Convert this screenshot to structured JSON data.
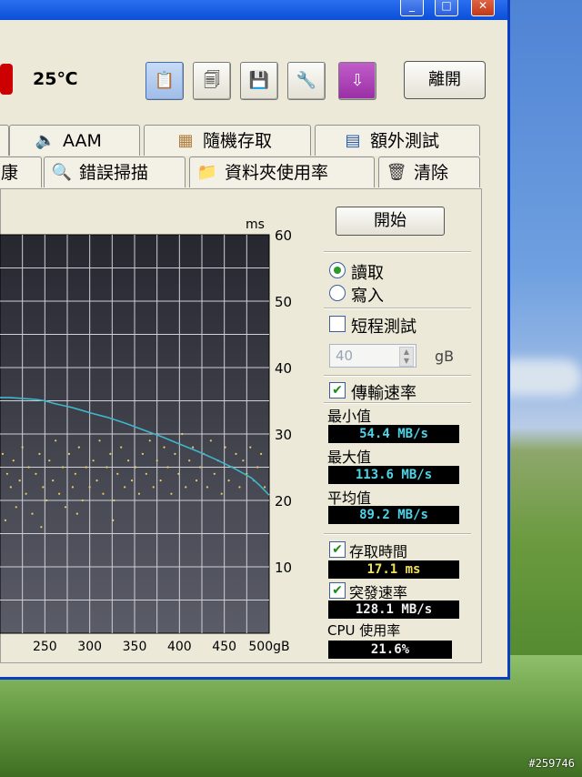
{
  "desktop": {
    "watermark": "#259746"
  },
  "window": {
    "controls": {
      "minimize": "_",
      "maximize": "□",
      "close": "✕"
    },
    "toolbar": {
      "temperature": "25℃",
      "icons": [
        "copy-text-icon",
        "copy-image-icon",
        "save-icon",
        "options-icon",
        "download-icon"
      ],
      "exit_label": "離開"
    },
    "tabs_row1": [
      {
        "label": "",
        "icon": ""
      },
      {
        "label": "AAM",
        "icon": "speaker-icon"
      },
      {
        "label": "隨機存取",
        "icon": "random-access-icon"
      },
      {
        "label": "額外測試",
        "icon": "extra-test-icon"
      }
    ],
    "tabs_row2": [
      {
        "label": "康",
        "icon": ""
      },
      {
        "label": "錯誤掃描",
        "icon": "magnifier-icon"
      },
      {
        "label": "資料夾使用率",
        "icon": "folder-icon"
      },
      {
        "label": "清除",
        "icon": "trash-icon"
      }
    ]
  },
  "panel": {
    "start_label": "開始",
    "read_label": "讀取",
    "write_label": "寫入",
    "mode": "read",
    "short_test_label": "短程測試",
    "short_test_checked": false,
    "short_test_size": "40",
    "short_test_unit": "gB",
    "transfer_rate_label": "傳輸速率",
    "transfer_rate_checked": true,
    "min_label": "最小值",
    "min_value": "54.4 MB/s",
    "max_label": "最大值",
    "max_value": "113.6 MB/s",
    "avg_label": "平均值",
    "avg_value": "89.2 MB/s",
    "access_time_label": "存取時間",
    "access_time_checked": true,
    "access_time_value": "17.1 ms",
    "burst_label": "突發速率",
    "burst_checked": true,
    "burst_value": "128.1 MB/s",
    "cpu_label": "CPU 使用率",
    "cpu_value": "21.6%"
  },
  "chart_data": {
    "type": "line",
    "right_axis_unit": "ms",
    "right_axis_ticks": [
      "60",
      "50",
      "40",
      "30",
      "20",
      "10"
    ],
    "x_ticks": [
      "250",
      "300",
      "350",
      "400",
      "450",
      "500gB"
    ],
    "xlim": [
      200,
      500
    ],
    "ylim_ms": [
      0,
      60
    ],
    "colors": {
      "transfer": "#3fb6cc",
      "access": "#e8d060",
      "background": "#2b2c35",
      "grid": "#cfcfd4"
    },
    "series": [
      {
        "x": [
          200,
          210,
          220,
          230,
          240,
          250,
          260,
          270,
          280,
          290,
          300,
          320,
          340,
          360,
          380,
          400,
          420,
          440,
          460,
          480,
          490,
          500
        ],
        "y_ms_scale": [
          35.5,
          35.5,
          35.4,
          35.3,
          35.2,
          35,
          34.6,
          34.3,
          34,
          33.6,
          33.2,
          32.5,
          31.6,
          30.6,
          29.6,
          28.5,
          27.4,
          26.2,
          24.9,
          23.4,
          22.2,
          20.8
        ]
      }
    ],
    "access_points": [
      [
        203,
        27
      ],
      [
        208,
        24
      ],
      [
        212,
        22
      ],
      [
        215,
        26
      ],
      [
        218,
        19
      ],
      [
        222,
        23
      ],
      [
        225,
        28
      ],
      [
        229,
        21
      ],
      [
        232,
        25
      ],
      [
        236,
        18
      ],
      [
        240,
        24
      ],
      [
        244,
        27
      ],
      [
        248,
        22
      ],
      [
        252,
        20
      ],
      [
        255,
        26
      ],
      [
        259,
        23
      ],
      [
        262,
        29
      ],
      [
        266,
        21
      ],
      [
        270,
        25
      ],
      [
        273,
        19
      ],
      [
        277,
        27
      ],
      [
        281,
        22
      ],
      [
        284,
        24
      ],
      [
        288,
        28
      ],
      [
        292,
        20
      ],
      [
        296,
        25
      ],
      [
        300,
        22
      ],
      [
        304,
        26
      ],
      [
        308,
        23
      ],
      [
        311,
        29
      ],
      [
        315,
        21
      ],
      [
        319,
        25
      ],
      [
        323,
        27
      ],
      [
        327,
        20
      ],
      [
        331,
        24
      ],
      [
        335,
        28
      ],
      [
        339,
        22
      ],
      [
        343,
        26
      ],
      [
        347,
        23
      ],
      [
        351,
        25
      ],
      [
        355,
        21
      ],
      [
        359,
        27
      ],
      [
        363,
        24
      ],
      [
        367,
        29
      ],
      [
        371,
        22
      ],
      [
        375,
        26
      ],
      [
        379,
        23
      ],
      [
        383,
        28
      ],
      [
        387,
        25
      ],
      [
        391,
        21
      ],
      [
        395,
        27
      ],
      [
        399,
        24
      ],
      [
        403,
        30
      ],
      [
        407,
        22
      ],
      [
        411,
        26
      ],
      [
        415,
        28
      ],
      [
        419,
        23
      ],
      [
        423,
        25
      ],
      [
        427,
        27
      ],
      [
        431,
        22
      ],
      [
        435,
        29
      ],
      [
        439,
        24
      ],
      [
        443,
        26
      ],
      [
        447,
        21
      ],
      [
        451,
        28
      ],
      [
        455,
        23
      ],
      [
        459,
        25
      ],
      [
        463,
        27
      ],
      [
        467,
        22
      ],
      [
        471,
        26
      ],
      [
        475,
        24
      ],
      [
        479,
        28
      ],
      [
        483,
        23
      ],
      [
        487,
        25
      ],
      [
        491,
        27
      ],
      [
        495,
        22
      ],
      [
        206,
        17
      ],
      [
        246,
        16
      ],
      [
        286,
        18
      ],
      [
        326,
        17
      ]
    ]
  }
}
